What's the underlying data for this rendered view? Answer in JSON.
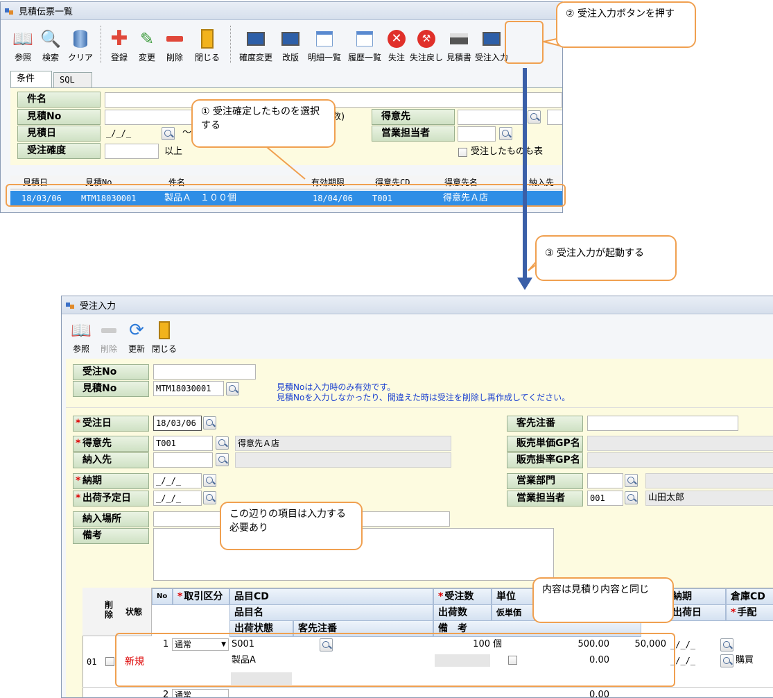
{
  "win1": {
    "title": "見積伝票一覧",
    "toolbar": [
      "参照",
      "検索",
      "クリア",
      "登録",
      "変更",
      "削除",
      "閉じる",
      "確度変更",
      "改版",
      "明細一覧",
      "履歴一覧",
      "失注",
      "失注戻し",
      "見積書",
      "受注入力"
    ],
    "tabs": [
      "条件",
      "SQL"
    ],
    "fields": {
      "kenmei": "件名",
      "mitsumori_no": "見積No",
      "mitsumori_bi": "見積日",
      "mitsumori_bi_value": "_/_/_",
      "tilde": "～",
      "kakudo": "受注確度",
      "ijou": "以上",
      "tokuisaki": "得意先",
      "eigyo_tanto": "営業担当者",
      "kaisuu_fragment": "数)",
      "checkbox_label": "受注したものも表"
    },
    "grid": {
      "headers": [
        "見積日",
        "見積No",
        "件名",
        "有効期限",
        "得意先CD",
        "得意先名",
        "納入先"
      ],
      "row": [
        "18/03/06",
        "MTM18030001",
        "製品Ａ　１００個",
        "18/04/06",
        "T001",
        "得意先Ａ店",
        ""
      ]
    }
  },
  "callouts": {
    "c1": "① 受注確定したものを選択する",
    "c2": "② 受注入力ボタンを押す",
    "c3": "③ 受注入力が起動する",
    "c4": "この辺りの項目は入力する必要あり",
    "c5": "内容は見積り内容と同じ"
  },
  "win2": {
    "title": "受注入力",
    "toolbar": [
      "参照",
      "削除",
      "更新",
      "閉じる"
    ],
    "juchu_no": "受注No",
    "mitsumori_no": "見積No",
    "mitsumori_no_value": "MTM18030001",
    "note1": "見積Noは入力時のみ有効です。",
    "note2": "見積Noを入力しなかったり、間違えた時は受注を削除し再作成してください。",
    "left": {
      "juchu_bi": "受注日",
      "juchu_bi_value": "18/03/06",
      "tokuisaki": "得意先",
      "tokuisaki_cd": "T001",
      "tokuisaki_name": "得意先Ａ店",
      "nounyusaki": "納入先",
      "nouki": "納期",
      "nouki_value": "_/_/_",
      "shukka_yotei": "出荷予定日",
      "shukka_yotei_value": "_/_/_",
      "nounyu_basho": "納入場所",
      "bikou": "備考"
    },
    "right": {
      "kyakusaki_chuban": "客先注番",
      "hanbai_tanka_gp": "販売単価GP名",
      "hanbai_kakeritsu_gp": "販売掛率GP名",
      "eigyo_bumon": "営業部門",
      "eigyo_tanto": "営業担当者",
      "eigyo_tanto_cd": "001",
      "eigyo_tanto_name": "山田太郎"
    },
    "grid": {
      "h_sakujo": "削除",
      "h_joutai": "状態",
      "h_no": "No",
      "h_torihiki": "取引区分",
      "h_hinmoku_cd": "品目CD",
      "h_hinmoku_mei": "品目名",
      "h_shukka_joutai": "出荷状態",
      "h_kyakusaki_chuban": "客先注番",
      "h_juchusu": "受注数",
      "h_shukkasu": "出荷数",
      "h_bikou": "備　考",
      "h_tani": "単位",
      "h_karitanka": "仮単価",
      "h_nouki": "納期",
      "h_shukkabi": "出荷日",
      "h_souko": "倉庫CD",
      "h_tehai": "手配",
      "row1": {
        "line": "01",
        "joutai": "新規",
        "no": "1",
        "torihiki": "通常",
        "hinmoku_cd": "S001",
        "hinmoku_mei": "製品A",
        "juchusu": "100",
        "tani": "個",
        "tanka": "500.00",
        "kingaku": "50,000",
        "tanka2": "0.00",
        "nouki": "_/_/_",
        "shukkabi": "_/_/_",
        "tehai": "購買"
      },
      "row2": {
        "no": "2",
        "torihiki": "通常",
        "tanka": "0.00"
      }
    }
  }
}
